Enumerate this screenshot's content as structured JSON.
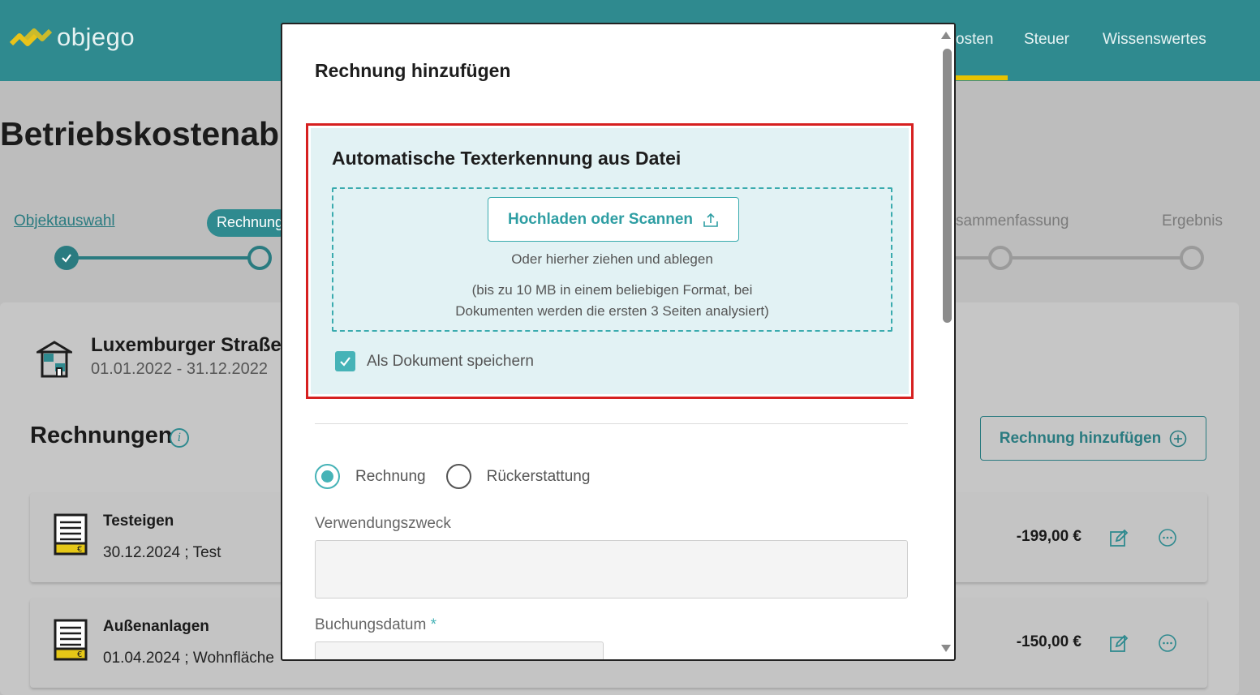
{
  "app": {
    "brand": "objego",
    "colors": {
      "teal": "#2f8a8f",
      "accent_teal": "#46b3b7",
      "highlight_red": "#d62020",
      "nav_underline": "#e7c200"
    }
  },
  "nav": {
    "items": [
      {
        "label": "osten"
      },
      {
        "label": "Steuer"
      },
      {
        "label": "Wissenswertes"
      }
    ]
  },
  "page": {
    "title": "Betriebskostenabre",
    "stepper": {
      "steps": [
        {
          "label": "Objektauswahl",
          "state": "done"
        },
        {
          "label": "Rechnung",
          "state": "active"
        },
        {
          "label": "sammenfassung",
          "state": "pending"
        },
        {
          "label": "Ergebnis",
          "state": "pending"
        }
      ]
    },
    "object": {
      "name": "Luxemburger Straße",
      "period": "01.01.2022 - 31.12.2022",
      "icon": "house-icon"
    },
    "invoices_section": {
      "title": "Rechnungen",
      "info_icon": "i",
      "add_button": "Rechnung hinzufügen",
      "rows": [
        {
          "title": "Testeigen",
          "subtitle": "30.12.2024 ; Test",
          "amount": "-199,00 €"
        },
        {
          "title": "Außenanlagen",
          "subtitle": "01.04.2024 ; Wohnfläche",
          "amount": "-150,00 €"
        }
      ]
    }
  },
  "modal": {
    "title": "Rechnung hinzufügen",
    "ocr": {
      "title": "Automatische Texterkennung aus Datei",
      "upload_button": "Hochladen oder Scannen",
      "drop_hint": "Oder hierher ziehen und ablegen",
      "limits_line1": "(bis zu 10 MB in einem beliebigen Format, bei",
      "limits_line2": "Dokumenten werden die ersten 3 Seiten analysiert)",
      "save_as_document": "Als Dokument speichern",
      "save_as_document_checked": true
    },
    "type_options": [
      {
        "label": "Rechnung",
        "selected": true
      },
      {
        "label": "Rückerstattung",
        "selected": false
      }
    ],
    "purpose_label": "Verwendungszweck",
    "purpose_value": "",
    "booking_date_label": "Buchungsdatum",
    "booking_date_required": "*",
    "booking_date_value": ""
  }
}
